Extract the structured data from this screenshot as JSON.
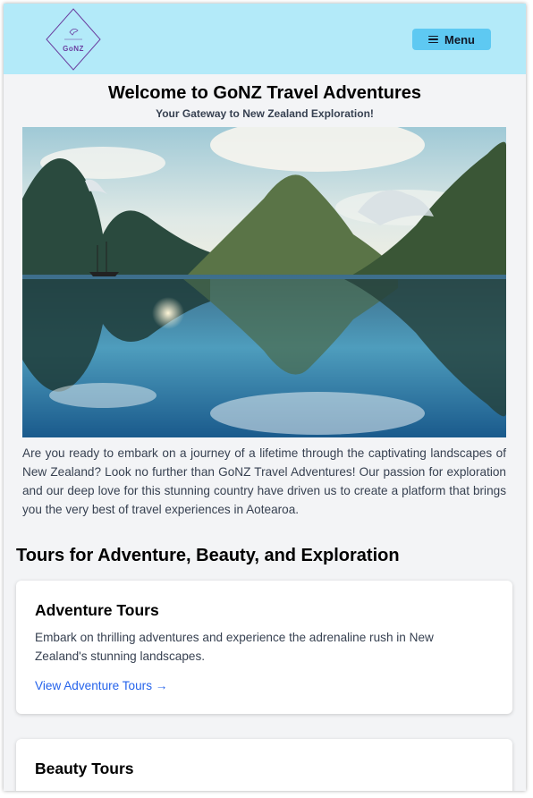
{
  "header": {
    "logo_text": "GoNZ",
    "menu_label": "Menu"
  },
  "hero": {
    "title": "Welcome to GoNZ Travel Adventures",
    "tagline": "Your Gateway to New Zealand Exploration!"
  },
  "intro": "Are you ready to embark on a journey of a lifetime through the captivating landscapes of New Zealand? Look no further than GoNZ Travel Adventures! Our passion for exploration and our deep love for this stunning country have driven us to create a platform that brings you the very best of travel experiences in Aotearoa.",
  "tours": {
    "section_title": "Tours for Adventure, Beauty, and Exploration",
    "cards": [
      {
        "title": "Adventure Tours",
        "description": "Embark on thrilling adventures and experience the adrenaline rush in New Zealand's stunning landscapes.",
        "link": "View Adventure Tours →"
      },
      {
        "title": "Beauty Tours"
      }
    ]
  },
  "colors": {
    "header_bg": "#b3eaf9",
    "menu_button": "#5ec9f2",
    "link": "#2563eb",
    "logo": "#6b3fa0"
  }
}
